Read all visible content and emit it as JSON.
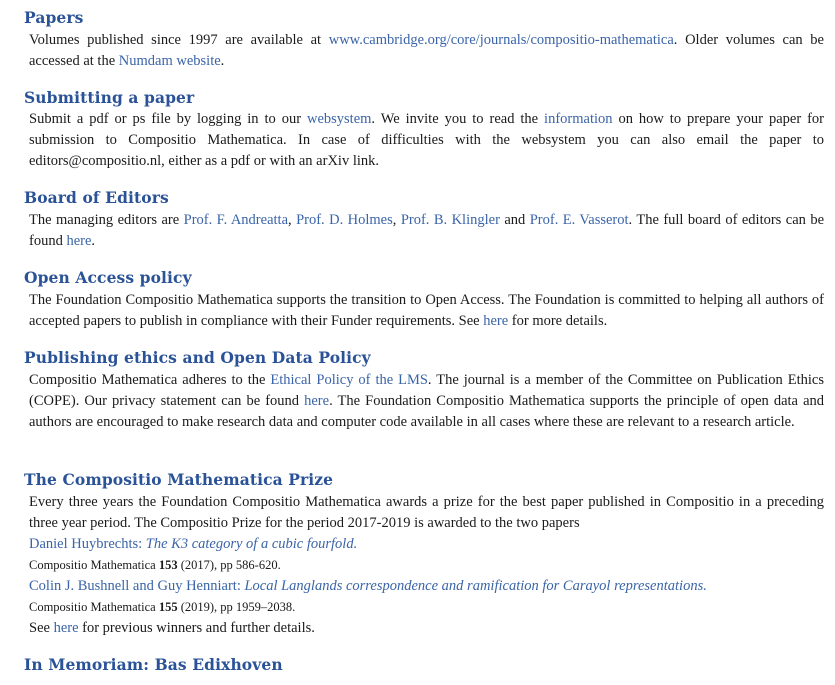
{
  "papers": {
    "heading": "Papers",
    "text1": "Volumes published since 1997 are available at ",
    "link_cambridge": "www.cambridge.org/core/journals/compositio-mathematica",
    "text2": ". Older volumes can be accessed at the ",
    "link_numdam": "Numdam website",
    "text3": "."
  },
  "submitting": {
    "heading": "Submitting a paper",
    "text1": "Submit a pdf or ps file by logging in to our ",
    "link_websystem": "websystem",
    "text2": ". We invite you to read the ",
    "link_information": "information",
    "text3": " on how to prepare your paper for submission to Compositio Mathematica. In case of difficulties with the websystem you can also email the paper to editors@compositio.nl, either as a pdf or with an arXiv link."
  },
  "board": {
    "heading": "Board of Editors",
    "text1": "The managing editors are ",
    "link_andreatta": "Prof. F. Andreatta",
    "sep1": ", ",
    "link_holmes": "Prof. D. Holmes",
    "sep2": ", ",
    "link_klingler": "Prof. B. Klingler",
    "sep3": " and ",
    "link_vasserot": "Prof. E. Vasserot",
    "text2": ". The full board of editors can be found ",
    "link_here": "here",
    "text3": "."
  },
  "open_access": {
    "heading": "Open Access policy",
    "text1": "The Foundation Compositio Mathematica supports the transition to Open Access. The Foundation is committed to helping all authors of accepted papers to publish in compliance with their Funder requirements. See ",
    "link_here": "here",
    "text2": " for more details."
  },
  "ethics": {
    "heading": "Publishing ethics and Open Data Policy",
    "text1": "Compositio Mathematica adheres to the ",
    "link_lms": "Ethical Policy of the LMS",
    "text2": ". The journal is a member of the Committee on Publication Ethics (COPE). Our privacy statement can be found ",
    "link_here": "here",
    "text3": ". The Foundation Compositio Mathematica supports the principle of open data and authors are encouraged to make research data and computer code available in all cases where these are relevant to a research article."
  },
  "prize": {
    "heading": "The Compositio Mathematica Prize",
    "intro": "Every three years the Foundation Compositio Mathematica awards a prize for the best paper published in Compositio in a preceding three year period. The Compositio Prize for the period 2017-2019 is awarded to the two papers",
    "papers": [
      {
        "authors": "Daniel Huybrechts: ",
        "title": "The K3 category of a cubic fourfold.",
        "journal": "Compositio Mathematica ",
        "volume": "153",
        "rest": " (2017), pp 586-620."
      },
      {
        "authors": "Colin J. Bushnell and Guy Henniart: ",
        "title": "Local Langlands correspondence and ramification for Carayol representations.",
        "journal": "Compositio Mathematica ",
        "volume": "155",
        "rest": " (2019), pp 1959–2038."
      }
    ],
    "outro1": "See ",
    "link_here": "here",
    "outro2": " for previous winners and further details."
  },
  "memoriam": {
    "heading": "In Memoriam: Bas Edixhoven"
  }
}
